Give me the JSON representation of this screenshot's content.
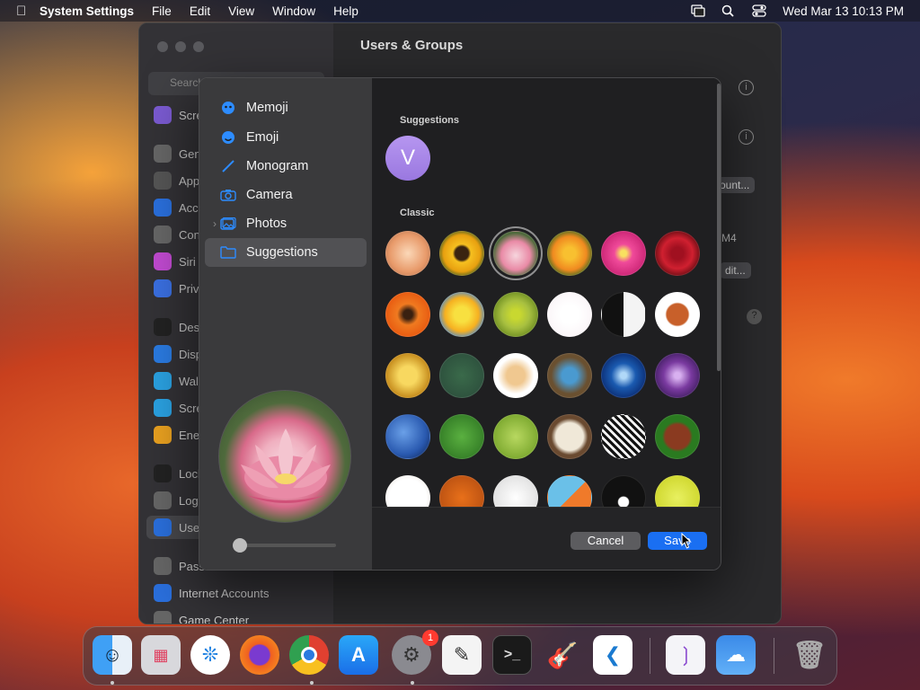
{
  "menubar": {
    "app_name": "System Settings",
    "menus": [
      "File",
      "Edit",
      "View",
      "Window",
      "Help"
    ],
    "datetime": "Wed Mar 13  10:13 PM"
  },
  "settings_window": {
    "title": "Users & Groups",
    "search_placeholder": "Search",
    "sidebar_fragments": [
      "Scre",
      "Gen",
      "App",
      "Acce",
      "Con",
      "Siri",
      "Priv",
      "Des",
      "Disp",
      "Wall",
      "Scre",
      "Ener",
      "Lock",
      "Logi",
      "Use",
      "Pass",
      "Internet Accounts",
      "Game Center"
    ],
    "right_fragments": {
      "account_btn": "ount...",
      "select_value": "M4",
      "edit_btn": "dit..."
    }
  },
  "dialog": {
    "sidebar": [
      {
        "label": "Memoji",
        "icon": "memoji-icon"
      },
      {
        "label": "Emoji",
        "icon": "emoji-icon"
      },
      {
        "label": "Monogram",
        "icon": "monogram-pen-icon"
      },
      {
        "label": "Camera",
        "icon": "camera-icon"
      },
      {
        "label": "Photos",
        "icon": "photos-icon"
      },
      {
        "label": "Suggestions",
        "icon": "folder-icon"
      }
    ],
    "selected_item": "Suggestions",
    "suggestions_label": "Suggestions",
    "monogram_letter": "V",
    "classic_label": "Classic",
    "classic_images": [
      [
        "rose-peach",
        "sunflower",
        "lotus",
        "poppy",
        "dahlia-pink",
        "red-rose"
      ],
      [
        "orange-flower",
        "yellow-daisy",
        "dandelion",
        "lips",
        "yin-yang",
        "gingerbread"
      ],
      [
        "gold-medal",
        "chalkboard",
        "fortune-cookie",
        "eggs-nest",
        "snowflake",
        "lightning"
      ],
      [
        "earth",
        "green-leaf",
        "leaves",
        "sand-dollar",
        "zebra",
        "football"
      ],
      [
        "baseball",
        "basketball",
        "golf-ball",
        "surfboard",
        "8-ball",
        "tennis-ball"
      ]
    ],
    "selected_image": "lotus",
    "cancel_label": "Cancel",
    "save_label": "Save"
  },
  "dock": {
    "apps": [
      "Finder",
      "Launchpad",
      "Safari",
      "Firefox",
      "Chrome",
      "App Store",
      "System Settings",
      "TextEdit",
      "Terminal",
      "GarageBand",
      "VS Code",
      "Visual Studio",
      "Weather",
      "Trash"
    ],
    "settings_badge": "1"
  }
}
